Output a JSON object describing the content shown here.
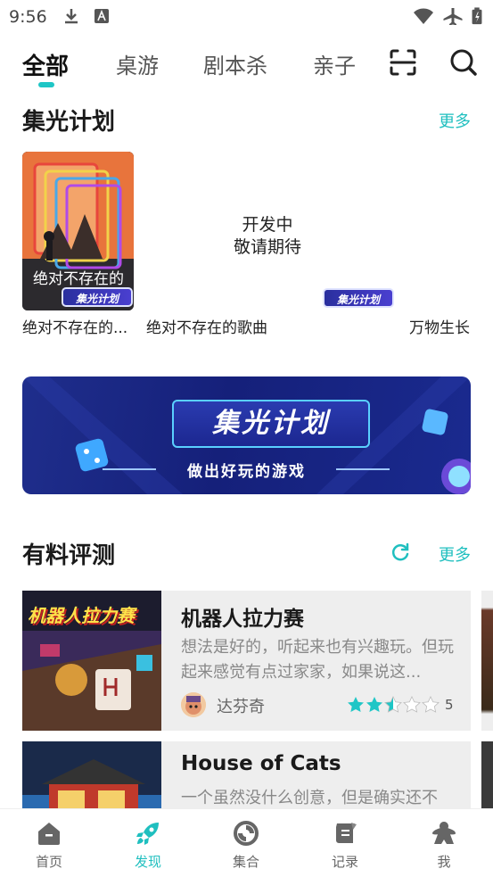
{
  "status_bar": {
    "time": "9:56"
  },
  "tabs": [
    {
      "label": "全部",
      "active": true
    },
    {
      "label": "桌游",
      "active": false
    },
    {
      "label": "剧本杀",
      "active": false
    },
    {
      "label": "亲子",
      "active": false
    }
  ],
  "toolbar_icons": [
    "scan-icon",
    "search-icon"
  ],
  "jiguang": {
    "title": "集光计划",
    "more": "更多",
    "items": [
      {
        "label": "绝对不存在的...",
        "cover_text": "绝对不存在的",
        "badge": "集光计划"
      },
      {
        "label": "绝对不存在的歌曲",
        "placeholder": [
          "开发中",
          "敬请期待"
        ]
      },
      {
        "label": "万物生长",
        "badge": "集光计划"
      }
    ]
  },
  "banner": {
    "title": "集光计划",
    "subtitle": "做出好玩的游戏"
  },
  "reviews": {
    "title": "有料评测",
    "more": "更多",
    "items": [
      {
        "title": "机器人拉力赛",
        "thumb_text": "机器人拉力赛",
        "text": "想法是好的，听起来也有兴趣玩。但玩起来感觉有点过家家，如果说这...",
        "author": "达芬奇",
        "rating": 2.5,
        "rating_label": "5"
      },
      {
        "title": "House of Cats",
        "text": "一个虽然没什么创意，但是确实还不"
      }
    ]
  },
  "bottom_nav": [
    {
      "label": "首页",
      "icon": "home-icon",
      "active": false
    },
    {
      "label": "发现",
      "icon": "rocket-icon",
      "active": true
    },
    {
      "label": "集合",
      "icon": "collection-icon",
      "active": false
    },
    {
      "label": "记录",
      "icon": "scroll-icon",
      "active": false
    },
    {
      "label": "我",
      "icon": "meeple-icon",
      "active": false
    }
  ],
  "colors": {
    "accent": "#1fbfbf",
    "star": "#1fc6c6",
    "banner": "#1a2a8f"
  }
}
